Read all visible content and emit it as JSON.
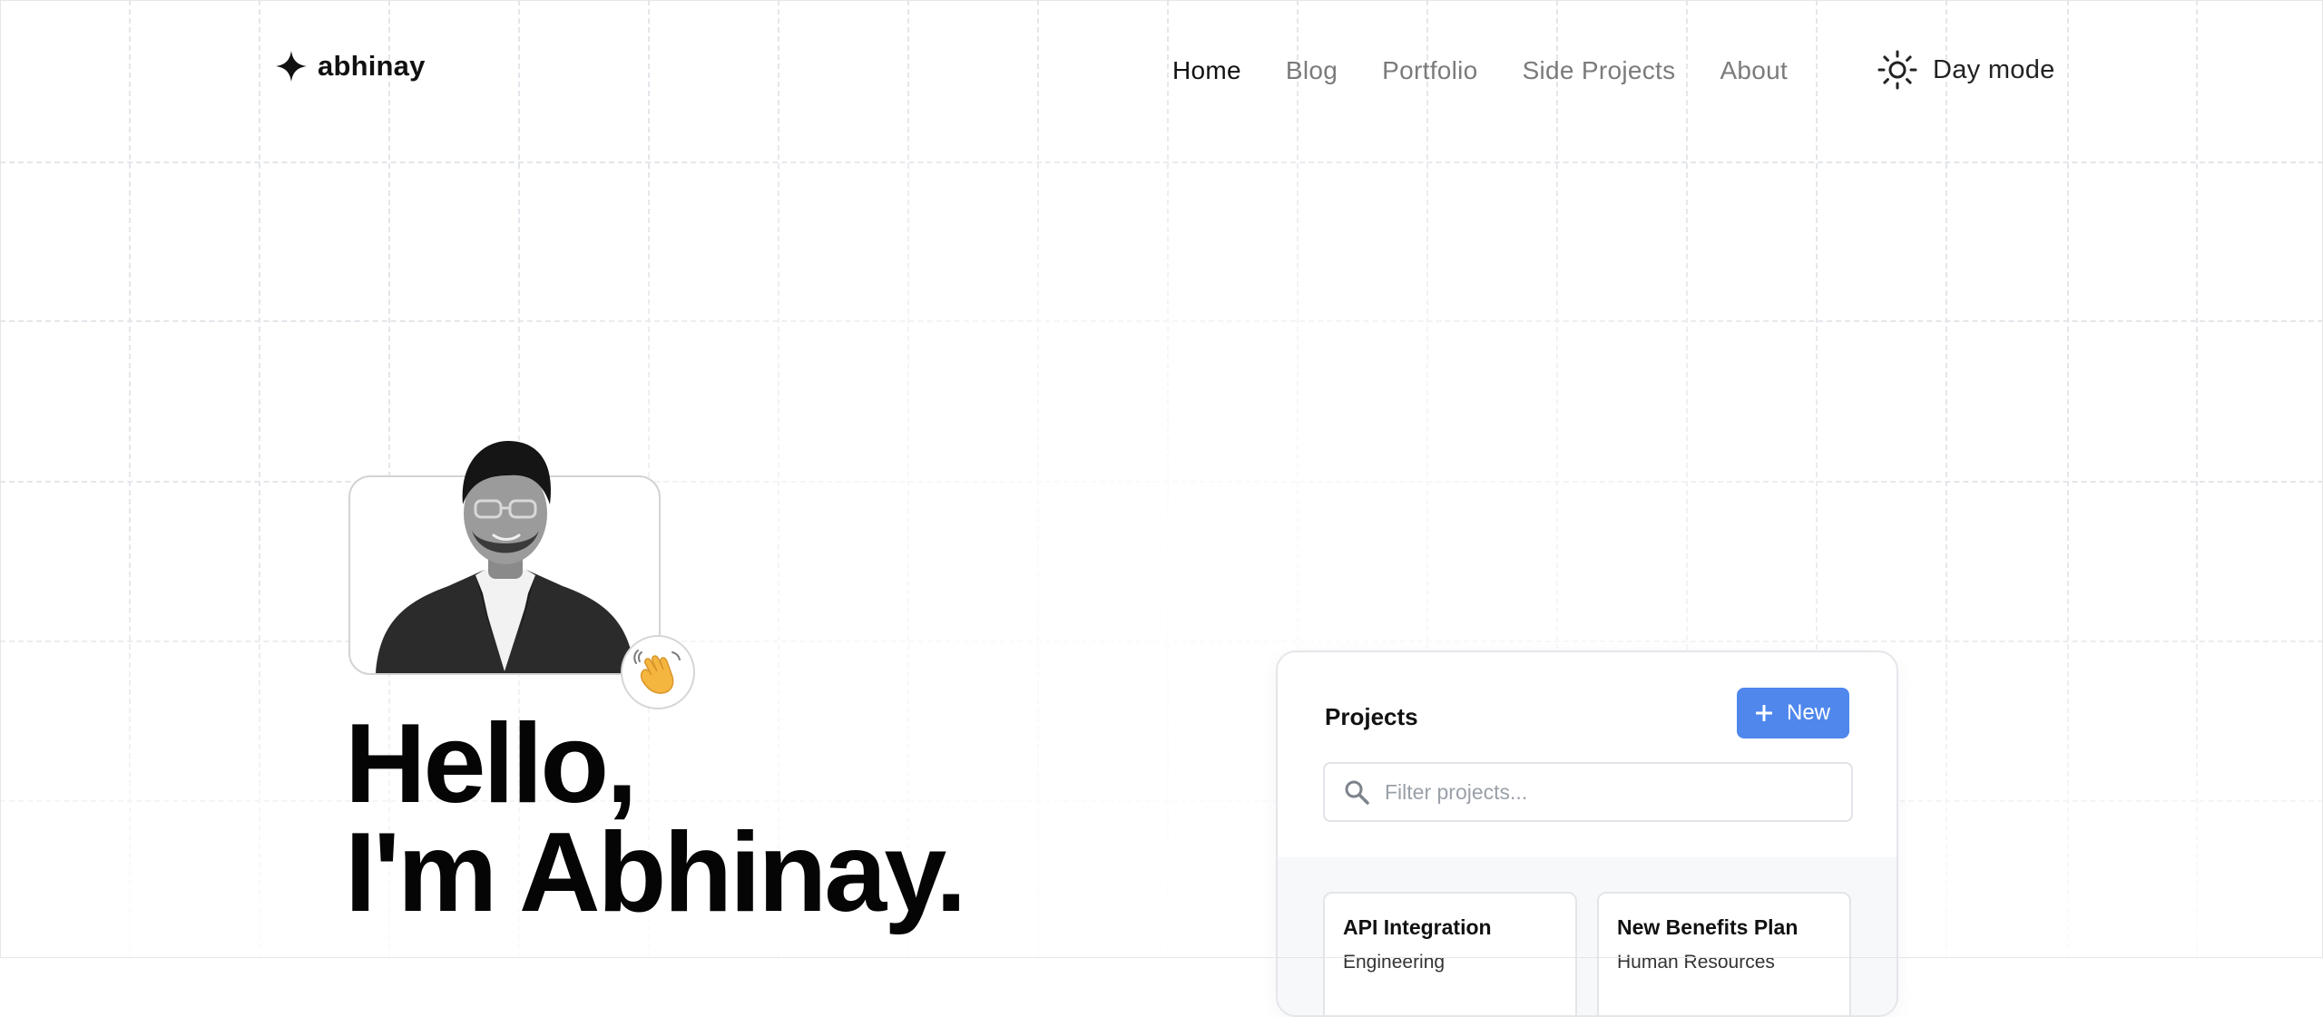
{
  "header": {
    "logo_text": "abhinay",
    "nav": [
      {
        "label": "Home",
        "active": true
      },
      {
        "label": "Blog",
        "active": false
      },
      {
        "label": "Portfolio",
        "active": false
      },
      {
        "label": "Side Projects",
        "active": false
      },
      {
        "label": "About",
        "active": false
      }
    ],
    "theme_toggle_label": "Day mode",
    "theme_icon": "sun-icon"
  },
  "hero": {
    "greeting_line1": "Hello,",
    "greeting_line2": "I'm Abhinay.",
    "badge_icon": "waving-hand-icon"
  },
  "projects_widget": {
    "title": "Projects",
    "new_button_label": "New",
    "filter_placeholder": "Filter projects...",
    "projects": [
      {
        "name": "API Integration",
        "department": "Engineering"
      },
      {
        "name": "New Benefits Plan",
        "department": "Human Resources"
      }
    ]
  },
  "colors": {
    "accent": "#4f87ed",
    "text_primary": "#111111",
    "text_muted": "#7b7b7b",
    "grid_line": "#e3e6ea",
    "card_border": "#e4e6ea",
    "card_body_bg": "#f7f8fa"
  }
}
